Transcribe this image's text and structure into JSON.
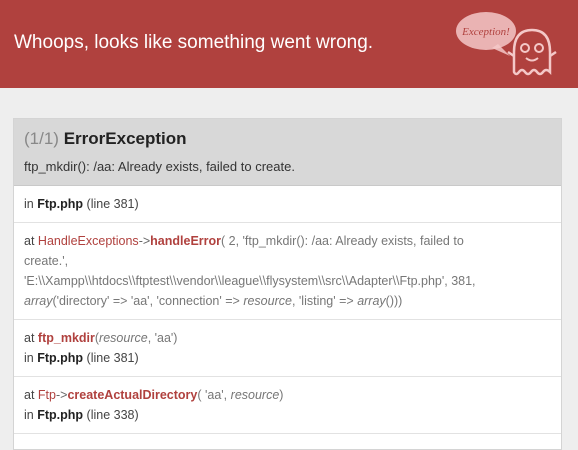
{
  "header": {
    "title": "Whoops, looks like something went wrong.",
    "bubble_text": "Exception!",
    "colors": {
      "header_bg": "#b0413e",
      "ghost": "#f4c8c8"
    }
  },
  "exception": {
    "count": "(1/1)",
    "name": "ErrorException",
    "message": "ftp_mkdir(): /aa: Already exists, failed to create."
  },
  "trace": [
    {
      "prefix": "in",
      "file": "Ftp.php",
      "line": "(line 381)"
    },
    {
      "at": "at",
      "class": "HandleExceptions",
      "arrow": "->",
      "func": "handleError",
      "args_line1": "( 2, 'ftp_mkdir(): /aa: Already exists, failed to",
      "args_line2": "create.',",
      "args_line3": "'E:\\\\Xampp\\\\htdocs\\\\ftptest\\\\vendor\\\\league\\\\flysystem\\\\src\\\\Adapter\\\\Ftp.php', 381,",
      "args_line4a": "array",
      "args_line4b": "('directory' => 'aa', 'connection' =>",
      "args_line4c": "resource",
      "args_line4d": ", 'listing' =>",
      "args_line4e": "array",
      "args_line4f": "()))"
    },
    {
      "at": "at",
      "func": "ftp_mkdir",
      "args_open": "(",
      "args_resource": "resource",
      "args_rest": ", 'aa')",
      "in": "in",
      "file": "Ftp.php",
      "line": "(line 381)"
    },
    {
      "at": "at",
      "class": "Ftp",
      "arrow": "->",
      "func": "createActualDirectory",
      "args_open": "( 'aa',",
      "args_resource": "resource",
      "args_close": ")",
      "in": "in",
      "file": "Ftp.php",
      "line": "(line 338)"
    }
  ]
}
